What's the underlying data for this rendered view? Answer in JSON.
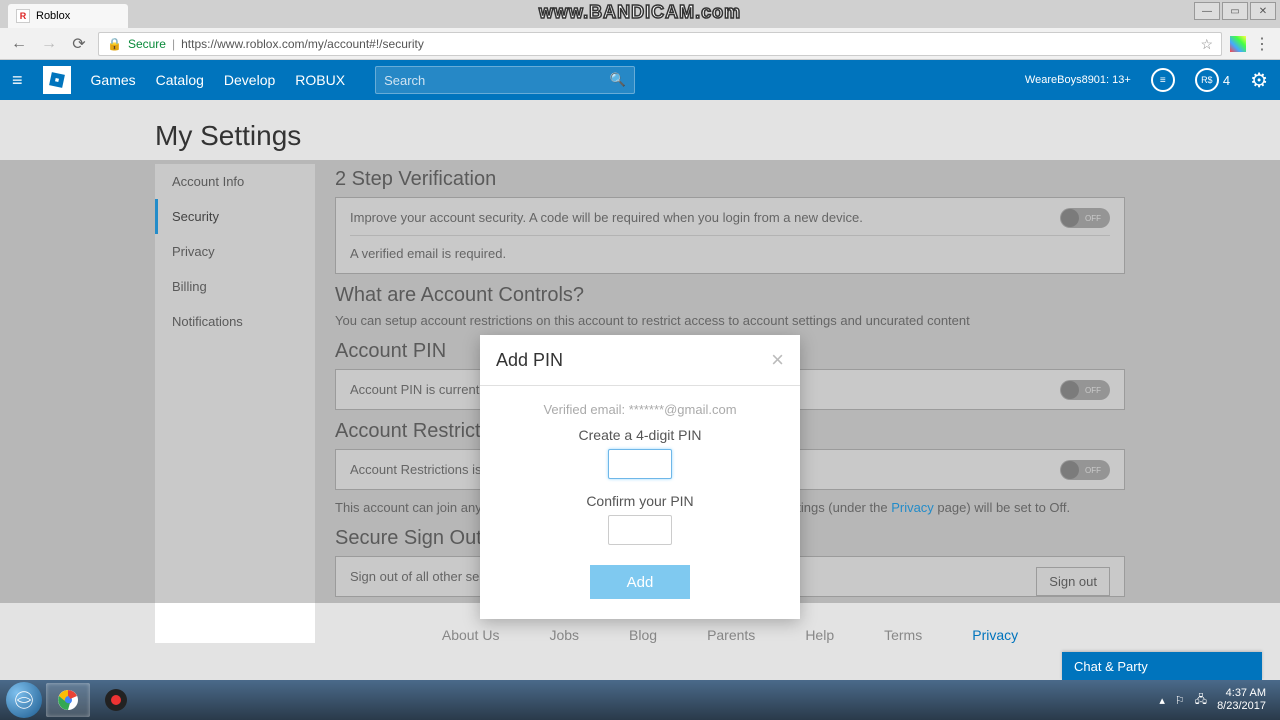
{
  "watermark": "www.BANDICAM.com",
  "browser": {
    "tab_title": "Roblox",
    "secure_label": "Secure",
    "url": "https://www.roblox.com/my/account#!/security"
  },
  "nav": {
    "links": [
      "Games",
      "Catalog",
      "Develop",
      "ROBUX"
    ],
    "search_placeholder": "Search",
    "username": "WeareBoys8901: 13+",
    "robux": "4"
  },
  "page": {
    "title": "My Settings",
    "tabs": [
      "Account Info",
      "Security",
      "Privacy",
      "Billing",
      "Notifications"
    ],
    "active_tab": 1,
    "two_step": {
      "title": "2 Step Verification",
      "desc": "Improve your account security. A code will be required when you login from a new device.",
      "note": "A verified email is required.",
      "toggle": "OFF"
    },
    "what_are": {
      "title": "What are Account Controls?",
      "desc_prefix": "You can setup account restrictions on this account to restrict access to account ",
      "desc_suffix": "settings and uncurated content"
    },
    "account_pin": {
      "title": "Account PIN",
      "desc": "Account PIN is currently disabled",
      "toggle": "OFF"
    },
    "restrictions": {
      "title": "Account Restrictions",
      "desc": "Account Restrictions is currently disabled",
      "toggle": "OFF",
      "body_prefix": "This account can join any game or search for any game. Additionally, contact settings (under the ",
      "privacy_link": "Privacy",
      "body_suffix": " page) will be set to Off."
    },
    "signout": {
      "title": "Secure Sign Out",
      "desc": "Sign out of all other sessions",
      "button": "Sign out"
    }
  },
  "footer": [
    "About Us",
    "Jobs",
    "Blog",
    "Parents",
    "Help",
    "Terms",
    "Privacy"
  ],
  "modal": {
    "title": "Add PIN",
    "verified_email": "Verified email: *******@gmail.com",
    "create_label": "Create a 4-digit PIN",
    "confirm_label": "Confirm your PIN",
    "add_button": "Add"
  },
  "chat_bar": "Chat & Party",
  "taskbar": {
    "time": "4:37 AM",
    "date": "8/23/2017"
  }
}
